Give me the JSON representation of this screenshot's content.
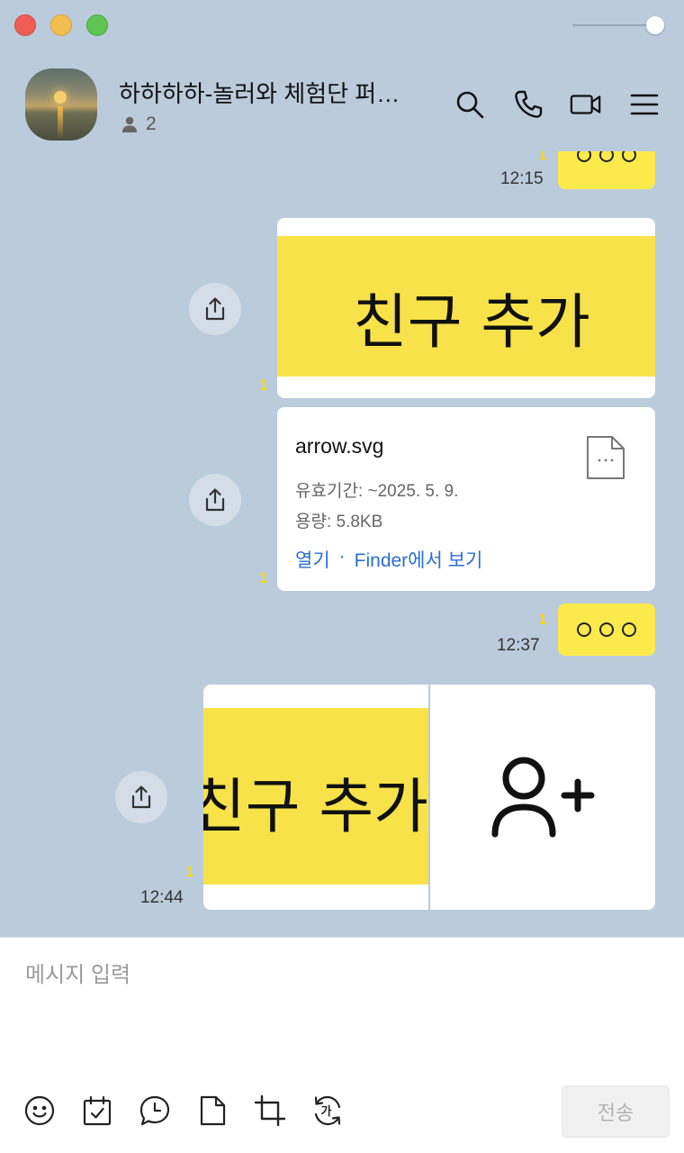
{
  "window": {
    "controls": [
      "close",
      "minimize",
      "zoom"
    ],
    "opacity_level": 1.0
  },
  "header": {
    "title": "하하하하-놀러와 체험단 퍼…",
    "member_count": "2",
    "icons": [
      "search-icon",
      "phone-icon",
      "video-icon",
      "menu-icon"
    ]
  },
  "messages": {
    "m1": {
      "time": "12:15",
      "unread": "1"
    },
    "m2": {
      "unread": "1",
      "image_text": "친구 추가"
    },
    "m3": {
      "unread": "1",
      "file_name": "arrow.svg",
      "expiry": "유효기간: ~2025. 5. 9.",
      "size": "용량: 5.8KB",
      "open_label": "열기",
      "separator": "·",
      "finder_label": "Finder에서 보기"
    },
    "m4": {
      "time": "12:37",
      "unread": "1"
    },
    "m5": {
      "time": "12:44",
      "unread": "1",
      "image_text": "친구 추가"
    }
  },
  "composer": {
    "placeholder": "메시지 입력",
    "value": "",
    "send_label": "전송",
    "tools": [
      "emoticon-icon",
      "calendar-icon",
      "reminder-icon",
      "file-icon",
      "capture-icon",
      "translate-icon"
    ]
  },
  "colors": {
    "background": "#bacbdc",
    "my_bubble": "#fce94c",
    "unread": "#f6d71d",
    "link": "#2a6fcf"
  }
}
